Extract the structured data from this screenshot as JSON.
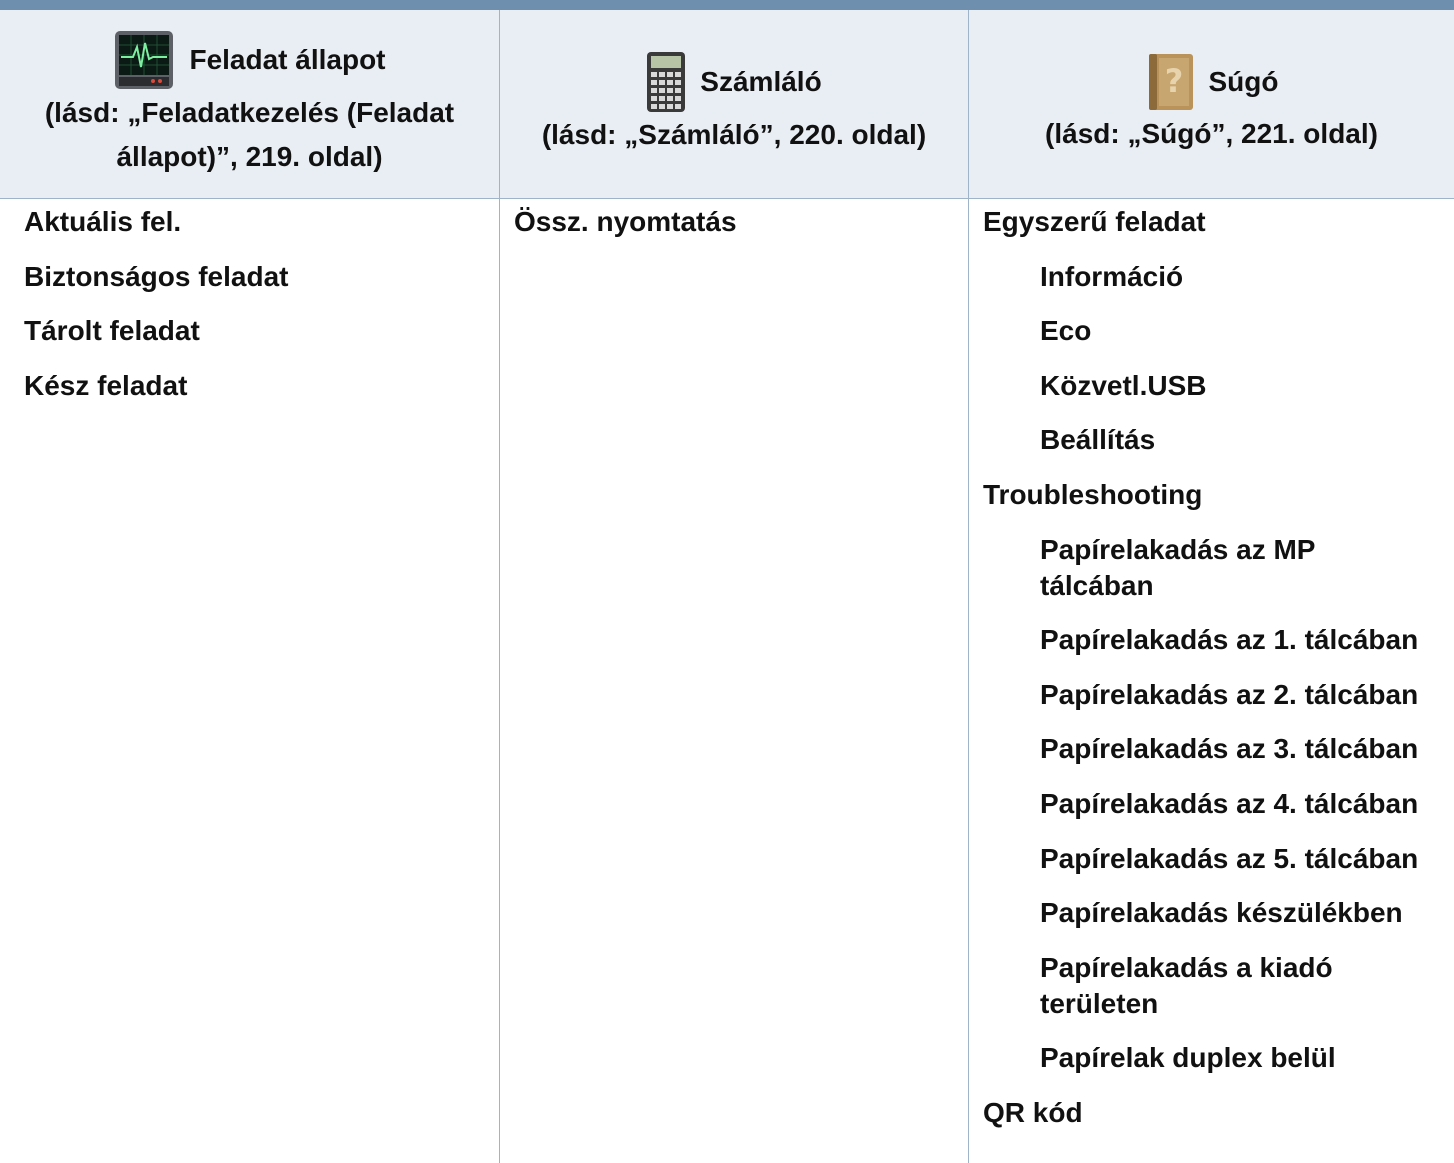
{
  "columns": [
    {
      "title": "Feladat állapot",
      "icon": "activity-monitor-icon",
      "reference": "(lásd: „Feladatkezelés (Feladat állapot)”, 219. oldal)",
      "items": [
        {
          "label": "Aktuális fel.",
          "level": 0
        },
        {
          "label": "Biztonságos feladat",
          "level": 0
        },
        {
          "label": "Tárolt feladat",
          "level": 0
        },
        {
          "label": "Kész feladat",
          "level": 0
        }
      ]
    },
    {
      "title": "Számláló",
      "icon": "calculator-icon",
      "reference": "(lásd: „Számláló”, 220. oldal)",
      "items": [
        {
          "label": "Össz. nyomtatás",
          "level": 0
        }
      ]
    },
    {
      "title": "Súgó",
      "icon": "help-book-icon",
      "reference": "(lásd: „Súgó”, 221. oldal)",
      "items": [
        {
          "label": "Egyszerű feladat",
          "level": 0
        },
        {
          "label": "Információ",
          "level": 1
        },
        {
          "label": "Eco",
          "level": 1
        },
        {
          "label": "Közvetl.USB",
          "level": 1
        },
        {
          "label": "Beállítás",
          "level": 1
        },
        {
          "label": "Troubleshooting",
          "level": 0
        },
        {
          "label": "Papírelakadás az MP tálcában",
          "level": 1
        },
        {
          "label": "Papírelakadás az 1. tálcában",
          "level": 1
        },
        {
          "label": "Papírelakadás az 2. tálcában",
          "level": 1
        },
        {
          "label": "Papírelakadás az 3. tálcában",
          "level": 1
        },
        {
          "label": "Papírelakadás az 4. tálcában",
          "level": 1
        },
        {
          "label": "Papírelakadás az 5. tálcában",
          "level": 1
        },
        {
          "label": "Papírelakadás készülékben",
          "level": 1
        },
        {
          "label": "Papírelakadás a kiadó területen",
          "level": 1
        },
        {
          "label": "Papírelak duplex belül",
          "level": 1
        },
        {
          "label": "QR kód",
          "level": 0
        }
      ]
    }
  ],
  "colors": {
    "header_bg": "#e9eef4",
    "rule": "#9fb4c9",
    "top_bar": "#6f8fae"
  }
}
